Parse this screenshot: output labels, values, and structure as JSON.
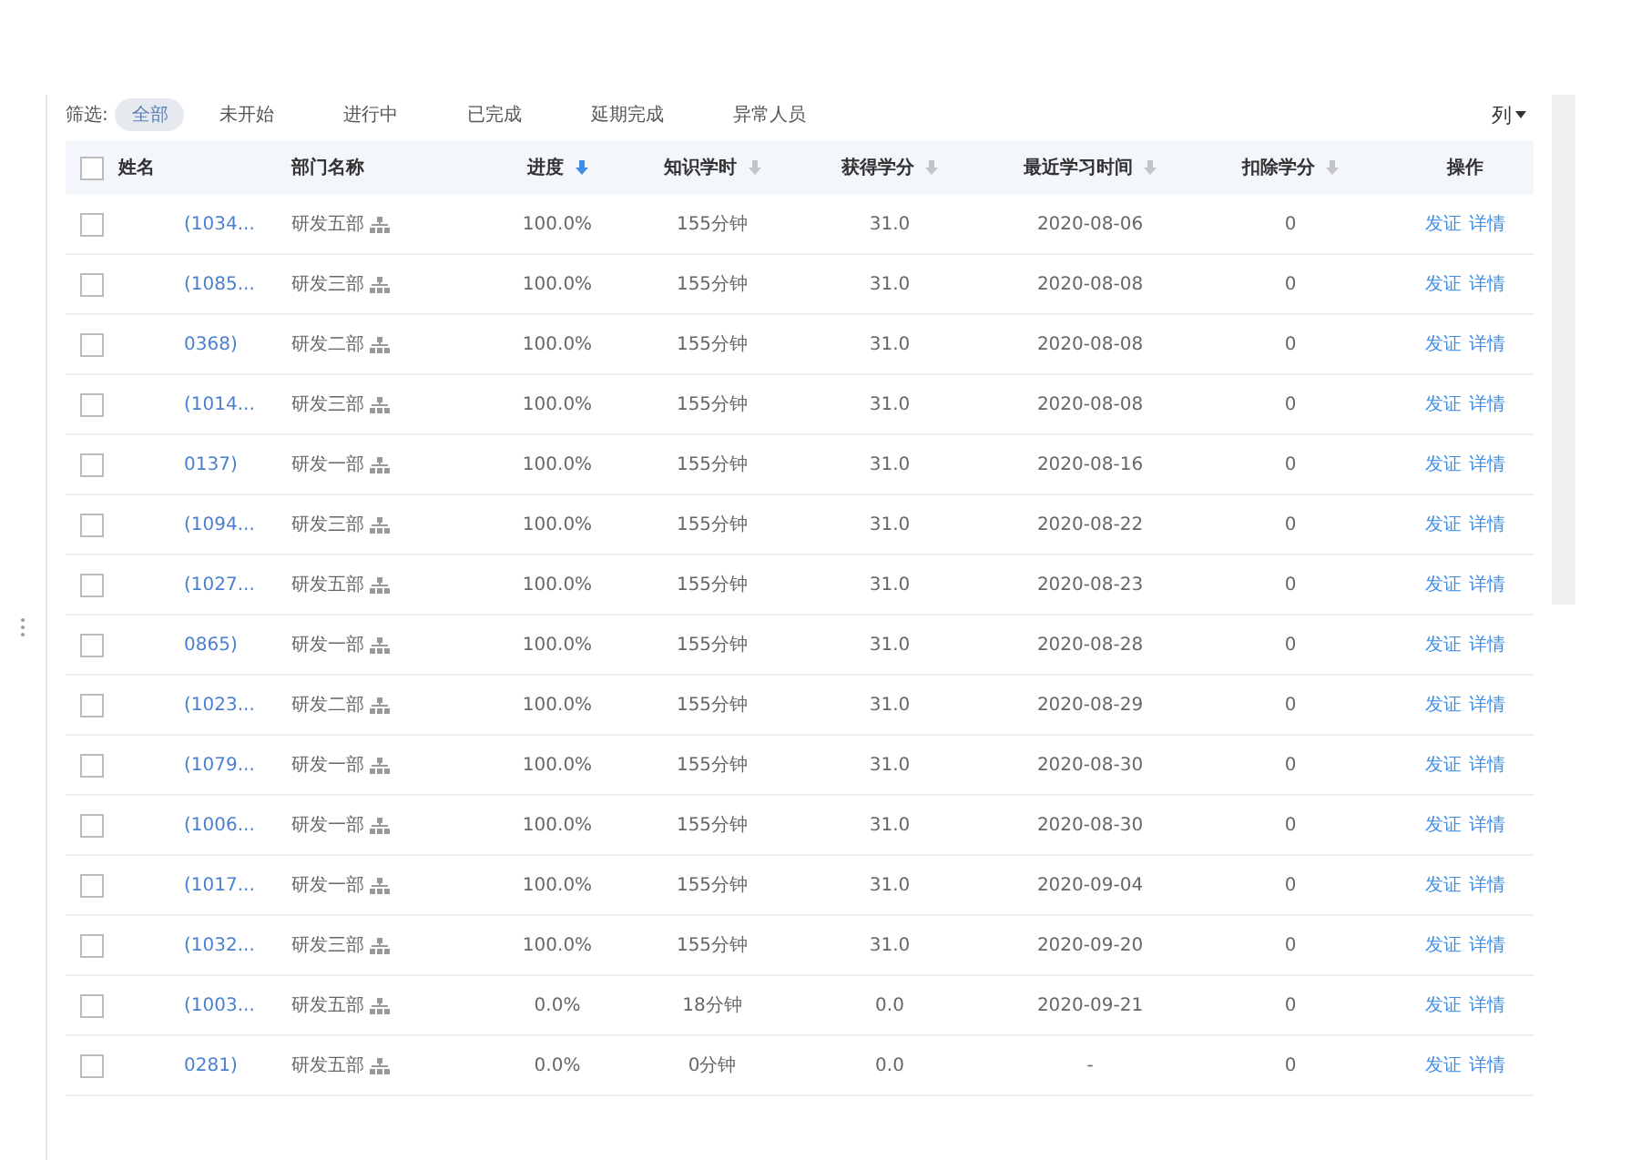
{
  "filter": {
    "label": "筛选:",
    "options": [
      {
        "label": "全部",
        "selected": true
      },
      {
        "label": "未开始",
        "selected": false
      },
      {
        "label": "进行中",
        "selected": false
      },
      {
        "label": "已完成",
        "selected": false
      },
      {
        "label": "延期完成",
        "selected": false
      },
      {
        "label": "异常人员",
        "selected": false
      }
    ]
  },
  "column_toggle": "列",
  "table": {
    "select_all_checked": false,
    "columns": [
      {
        "label": "姓名",
        "sortable": false,
        "sorted": false
      },
      {
        "label": "部门名称",
        "sortable": false,
        "sorted": false
      },
      {
        "label": "进度",
        "sortable": true,
        "sorted": true
      },
      {
        "label": "知识学时",
        "sortable": true,
        "sorted": false
      },
      {
        "label": "获得学分",
        "sortable": true,
        "sorted": false
      },
      {
        "label": "最近学习时间",
        "sortable": true,
        "sorted": false
      },
      {
        "label": "扣除学分",
        "sortable": true,
        "sorted": false
      },
      {
        "label": "操作",
        "sortable": false,
        "sorted": false
      }
    ],
    "rows": [
      {
        "checked": false,
        "id": "(1034...",
        "department": "研发五部",
        "progress": "100.0%",
        "hours": "155分钟",
        "credits": "31.0",
        "last_study": "2020-08-06",
        "deducted": "0",
        "actions": [
          "发证",
          "详情"
        ]
      },
      {
        "checked": false,
        "id": "(1085...",
        "department": "研发三部",
        "progress": "100.0%",
        "hours": "155分钟",
        "credits": "31.0",
        "last_study": "2020-08-08",
        "deducted": "0",
        "actions": [
          "发证",
          "详情"
        ]
      },
      {
        "checked": false,
        "id": "0368)",
        "department": "研发二部",
        "progress": "100.0%",
        "hours": "155分钟",
        "credits": "31.0",
        "last_study": "2020-08-08",
        "deducted": "0",
        "actions": [
          "发证",
          "详情"
        ]
      },
      {
        "checked": false,
        "id": "(1014...",
        "department": "研发三部",
        "progress": "100.0%",
        "hours": "155分钟",
        "credits": "31.0",
        "last_study": "2020-08-08",
        "deducted": "0",
        "actions": [
          "发证",
          "详情"
        ]
      },
      {
        "checked": false,
        "id": "0137)",
        "department": "研发一部",
        "progress": "100.0%",
        "hours": "155分钟",
        "credits": "31.0",
        "last_study": "2020-08-16",
        "deducted": "0",
        "actions": [
          "发证",
          "详情"
        ]
      },
      {
        "checked": false,
        "id": "(1094...",
        "department": "研发三部",
        "progress": "100.0%",
        "hours": "155分钟",
        "credits": "31.0",
        "last_study": "2020-08-22",
        "deducted": "0",
        "actions": [
          "发证",
          "详情"
        ]
      },
      {
        "checked": false,
        "id": "(1027...",
        "department": "研发五部",
        "progress": "100.0%",
        "hours": "155分钟",
        "credits": "31.0",
        "last_study": "2020-08-23",
        "deducted": "0",
        "actions": [
          "发证",
          "详情"
        ]
      },
      {
        "checked": false,
        "id": "0865)",
        "department": "研发一部",
        "progress": "100.0%",
        "hours": "155分钟",
        "credits": "31.0",
        "last_study": "2020-08-28",
        "deducted": "0",
        "actions": [
          "发证",
          "详情"
        ]
      },
      {
        "checked": false,
        "id": "(1023...",
        "department": "研发二部",
        "progress": "100.0%",
        "hours": "155分钟",
        "credits": "31.0",
        "last_study": "2020-08-29",
        "deducted": "0",
        "actions": [
          "发证",
          "详情"
        ]
      },
      {
        "checked": false,
        "id": "(1079...",
        "department": "研发一部",
        "progress": "100.0%",
        "hours": "155分钟",
        "credits": "31.0",
        "last_study": "2020-08-30",
        "deducted": "0",
        "actions": [
          "发证",
          "详情"
        ]
      },
      {
        "checked": false,
        "id": "(1006...",
        "department": "研发一部",
        "progress": "100.0%",
        "hours": "155分钟",
        "credits": "31.0",
        "last_study": "2020-08-30",
        "deducted": "0",
        "actions": [
          "发证",
          "详情"
        ]
      },
      {
        "checked": false,
        "id": "(1017...",
        "department": "研发一部",
        "progress": "100.0%",
        "hours": "155分钟",
        "credits": "31.0",
        "last_study": "2020-09-04",
        "deducted": "0",
        "actions": [
          "发证",
          "详情"
        ]
      },
      {
        "checked": false,
        "id": "(1032...",
        "department": "研发三部",
        "progress": "100.0%",
        "hours": "155分钟",
        "credits": "31.0",
        "last_study": "2020-09-20",
        "deducted": "0",
        "actions": [
          "发证",
          "详情"
        ]
      },
      {
        "checked": false,
        "id": "(1003...",
        "department": "研发五部",
        "progress": "0.0%",
        "hours": "18分钟",
        "credits": "0.0",
        "last_study": "2020-09-21",
        "deducted": "0",
        "actions": [
          "发证",
          "详情"
        ]
      },
      {
        "checked": false,
        "id": "0281)",
        "department": "研发五部",
        "progress": "0.0%",
        "hours": "0分钟",
        "credits": "0.0",
        "last_study": "-",
        "deducted": "0",
        "actions": [
          "发证",
          "详情"
        ]
      }
    ]
  }
}
